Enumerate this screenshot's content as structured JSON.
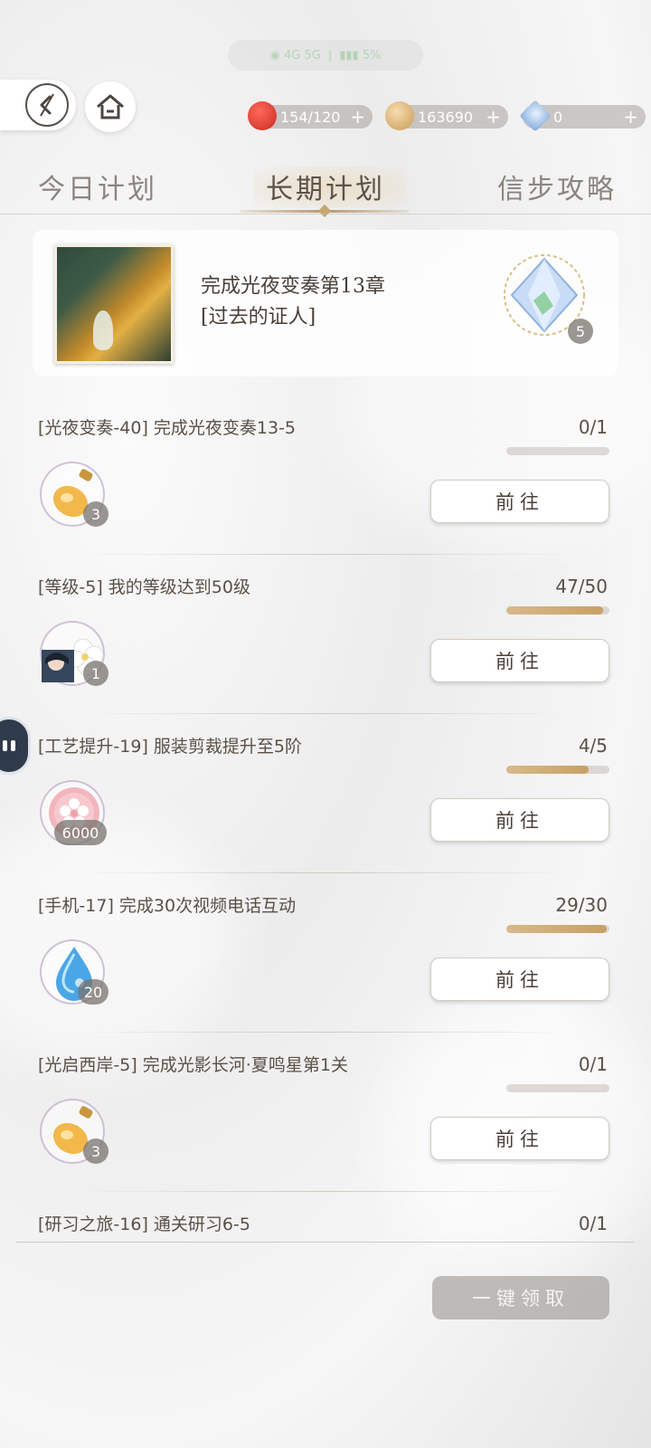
{
  "status": {
    "text_left": "◉ 4G 5G",
    "text_right": "▮▮▮ 5%"
  },
  "resources": [
    {
      "icon": "apple-stamina-icon",
      "value": "154/120",
      "color": "#d23a2e"
    },
    {
      "icon": "gold-coin-icon",
      "value": "163690",
      "color": "#d9a55a"
    },
    {
      "icon": "diamond-gem-icon",
      "value": "0",
      "color": "#7ea6d8"
    }
  ],
  "tabs": [
    {
      "label": "今日计划",
      "active": false
    },
    {
      "label": "长期计划",
      "active": true
    },
    {
      "label": "信步攻略",
      "active": false
    }
  ],
  "feature": {
    "line1": "完成光夜变奏第13章",
    "line2": "[过去的证人]",
    "reward_icon": "crystal-diamond-icon",
    "reward_count": "5"
  },
  "tasks": [
    {
      "label": "[光夜变奏-40] 完成光夜变奏13-5",
      "progress_text": "0/1",
      "progress": 0.0,
      "reward_icon": "perfume-bottle-icon",
      "reward_count": "3",
      "button": "前往"
    },
    {
      "label": "[等级-5] 我的等级达到50级",
      "progress_text": "47/50",
      "progress": 0.94,
      "reward_icon": "character-card-flower-icon",
      "reward_count": "1",
      "button": "前往"
    },
    {
      "label": "[工艺提升-19] 服装剪裁提升至5阶",
      "progress_text": "4/5",
      "progress": 0.8,
      "reward_icon": "pink-flower-token-icon",
      "reward_count": "6000",
      "button": "前往"
    },
    {
      "label": "[手机-17] 完成30次视频电话互动",
      "progress_text": "29/30",
      "progress": 0.97,
      "reward_icon": "blue-water-drop-icon",
      "reward_count": "20",
      "button": "前往"
    },
    {
      "label": "[光启西岸-5] 完成光影长河·夏鸣星第1关",
      "progress_text": "0/1",
      "progress": 0.0,
      "reward_icon": "perfume-bottle-icon",
      "reward_count": "3",
      "button": "前往"
    },
    {
      "label": "[研习之旅-16] 通关研习6-5",
      "progress_text": "0/1",
      "progress": 0.0
    }
  ],
  "claim_all": "一键领取"
}
